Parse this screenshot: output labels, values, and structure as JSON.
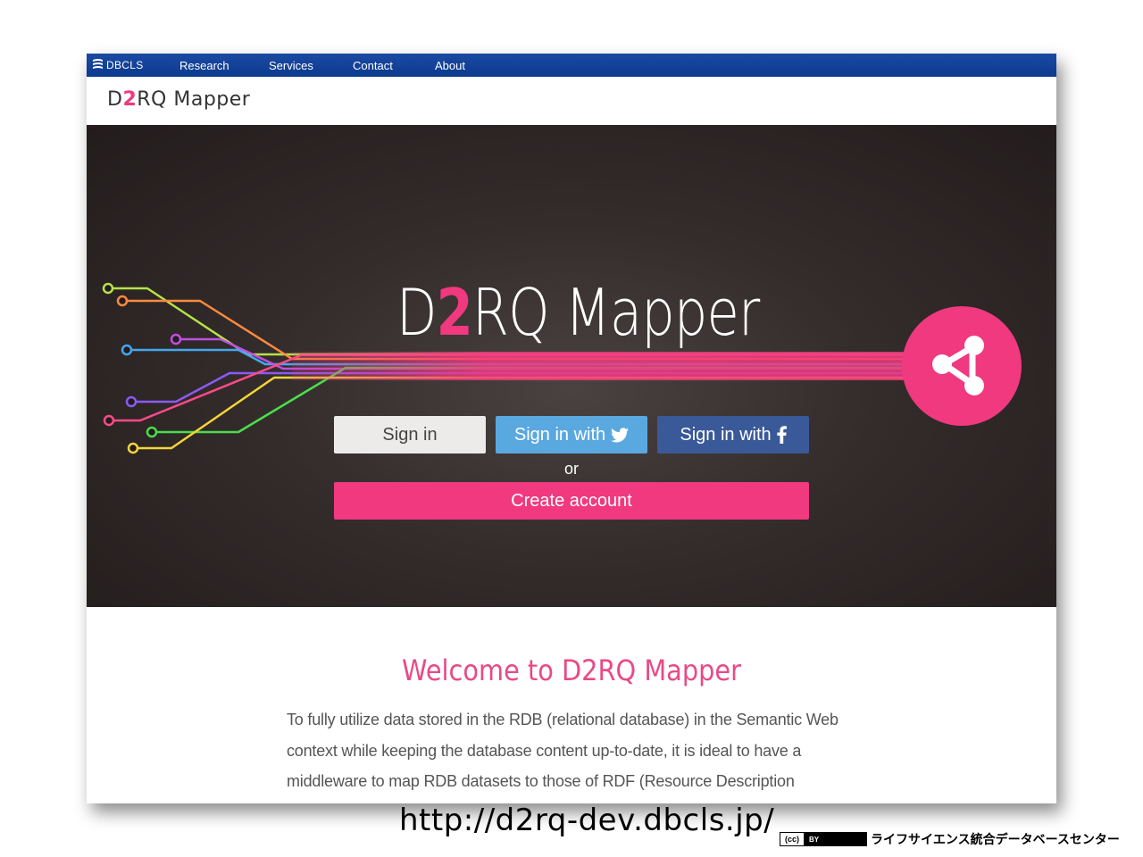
{
  "topbar": {
    "brand": "DBCLS",
    "nav": [
      "Research",
      "Services",
      "Contact",
      "About"
    ]
  },
  "site": {
    "logo_prefix": "D",
    "logo_two": "2",
    "logo_suffix": "RQ Mapper"
  },
  "hero": {
    "title_prefix": "D",
    "title_two": "2",
    "title_suffix": "RQ Mapper",
    "signin_label": "Sign in",
    "signin_twitter_label": "Sign in with",
    "signin_facebook_label": "Sign in with",
    "or_label": "or",
    "create_account_label": "Create account"
  },
  "welcome": {
    "heading": "Welcome to D2RQ Mapper",
    "intro": "To fully utilize data stored in the RDB (relational database) in the Semantic Web context while keeping the database content up-to-date, it is ideal to have a middleware to map RDB datasets to those of RDF (Resource Description Framework) graph and to"
  },
  "footer": {
    "url": "http://d2rq-dev.dbcls.jp/",
    "license_cc": "(cc)",
    "license_by": "BY",
    "org": "ライフサイエンス統合データベースセンター"
  },
  "colors": {
    "accent_pink": "#f0397f",
    "topbar_blue": "#0c3a8e",
    "twitter_blue": "#5aa8e0",
    "facebook_blue": "#3a5998",
    "hero_bg": "#2d2625"
  },
  "icons": [
    "dbcls-logo-icon",
    "share-icon",
    "twitter-icon",
    "facebook-icon"
  ]
}
